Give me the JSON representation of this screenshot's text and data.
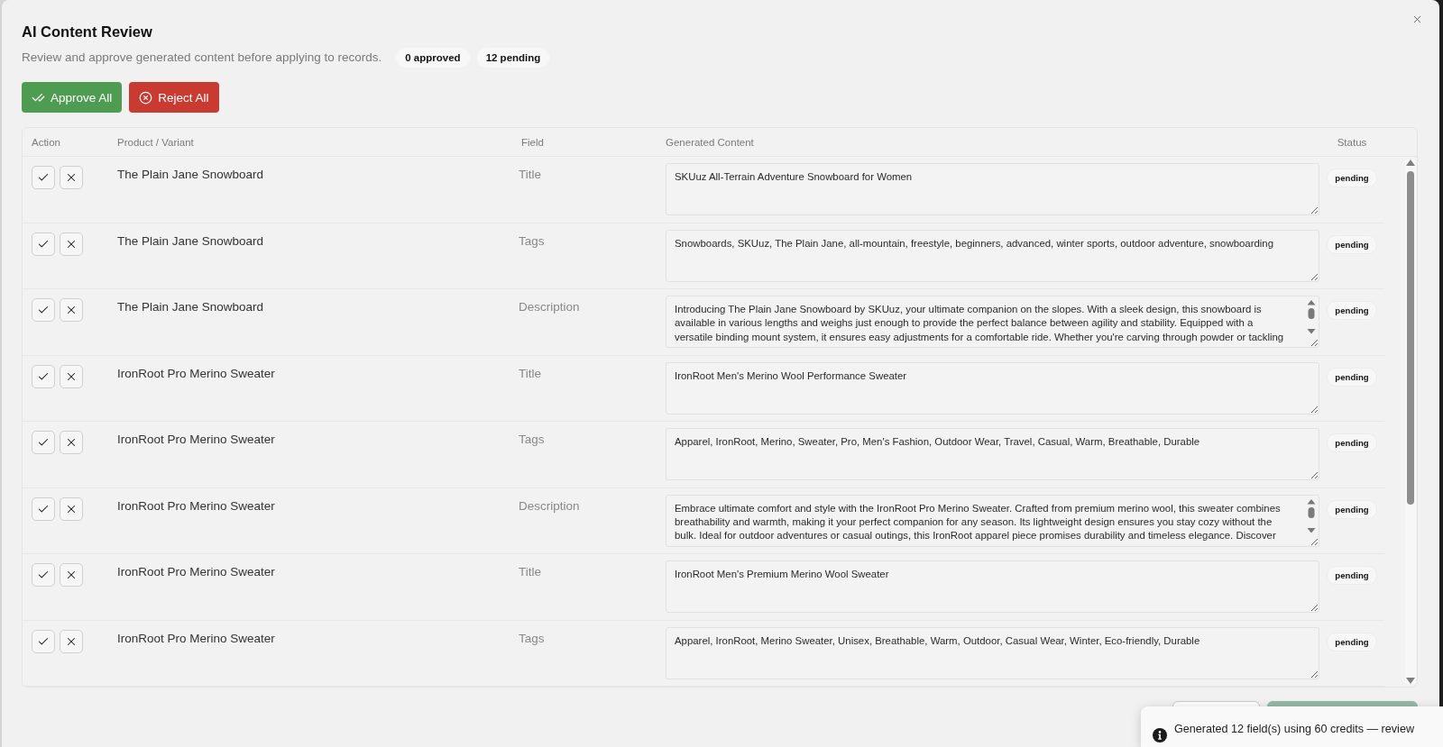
{
  "dialog": {
    "title": "AI Content Review",
    "subtitle": "Review and approve generated content before applying to records.",
    "counts": [
      "0 approved",
      "12 pending"
    ]
  },
  "actions": [
    {
      "label": "Approve All",
      "kind": "approve"
    },
    {
      "label": "Reject All",
      "kind": "reject"
    }
  ],
  "table": {
    "columns": [
      "Action",
      "Product / Variant",
      "Field",
      "Generated Content",
      "Status"
    ],
    "rows": [
      {
        "product": "The Plain Jane Snowboard",
        "field": "Title",
        "content": "SKUuz All-Terrain Adventure Snowboard for Women",
        "status": "pending",
        "scrollable": false
      },
      {
        "product": "The Plain Jane Snowboard",
        "field": "Tags",
        "content": "Snowboards, SKUuz, The Plain Jane, all-mountain, freestyle, beginners, advanced, winter sports, outdoor adventure, snowboarding",
        "status": "pending",
        "scrollable": false
      },
      {
        "product": "The Plain Jane Snowboard",
        "field": "Description",
        "content": "Introducing The Plain Jane Snowboard by SKUuz, your ultimate companion on the slopes. With a sleek design, this snowboard is available in various lengths and weighs just enough to provide the perfect balance between agility and stability. Equipped with a versatile binding mount system, it ensures easy adjustments for a comfortable ride. Whether you're carving through powder or tackling",
        "status": "pending",
        "scrollable": true
      },
      {
        "product": "IronRoot Pro Merino Sweater",
        "field": "Title",
        "content": "IronRoot Men's Merino Wool Performance Sweater",
        "status": "pending",
        "scrollable": false
      },
      {
        "product": "IronRoot Pro Merino Sweater",
        "field": "Tags",
        "content": "Apparel, IronRoot, Merino, Sweater, Pro, Men's Fashion, Outdoor Wear, Travel, Casual, Warm, Breathable, Durable",
        "status": "pending",
        "scrollable": false
      },
      {
        "product": "IronRoot Pro Merino Sweater",
        "field": "Description",
        "content": "Embrace ultimate comfort and style with the IronRoot Pro Merino Sweater. Crafted from premium merino wool, this sweater combines breathability and warmth, making it your perfect companion for any season. Its lightweight design ensures you stay cozy without the bulk. Ideal for outdoor adventures or casual outings, this IronRoot apparel piece promises durability and timeless elegance. Discover",
        "status": "pending",
        "scrollable": true
      },
      {
        "product": "IronRoot Pro Merino Sweater",
        "field": "Title",
        "content": "IronRoot Men's Premium Merino Wool Sweater",
        "status": "pending",
        "scrollable": false
      },
      {
        "product": "IronRoot Pro Merino Sweater",
        "field": "Tags",
        "content": "Apparel, IronRoot, Merino Sweater, Unisex, Breathable, Warm, Outdoor, Casual Wear, Winter, Eco-friendly, Durable",
        "status": "pending",
        "scrollable": false
      }
    ]
  },
  "footer_buttons": [
    {
      "kind": "outline",
      "disabled": false
    },
    {
      "kind": "primary",
      "disabled": true
    }
  ],
  "toast": {
    "message": "Generated 12 field(s) using 60 credits — review"
  }
}
